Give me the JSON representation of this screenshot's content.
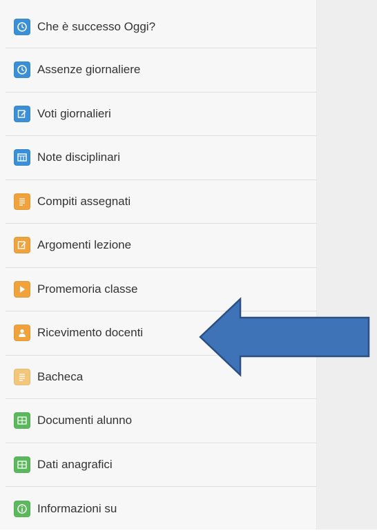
{
  "menu": {
    "items": [
      {
        "label": "Che è successo Oggi?",
        "icon": "clock-icon",
        "color": "#3a8fd6"
      },
      {
        "label": "Assenze giornaliere",
        "icon": "clock-icon",
        "color": "#3a8fd6"
      },
      {
        "label": "Voti giornalieri",
        "icon": "edit-icon",
        "color": "#3a8fd6"
      },
      {
        "label": "Note disciplinari",
        "icon": "calendar-icon",
        "color": "#3a8fd6"
      },
      {
        "label": "Compiti assegnati",
        "icon": "document-icon",
        "color": "#f0a23c"
      },
      {
        "label": "Argomenti lezione",
        "icon": "edit-icon",
        "color": "#f0a23c"
      },
      {
        "label": "Promemoria classe",
        "icon": "pin-icon",
        "color": "#f0a23c"
      },
      {
        "label": "Ricevimento docenti",
        "icon": "person-icon",
        "color": "#f0a23c"
      },
      {
        "label": "Bacheca",
        "icon": "document-icon",
        "color": "#f2c77a"
      },
      {
        "label": "Documenti alunno",
        "icon": "grid-icon",
        "color": "#5cb85c"
      },
      {
        "label": "Dati anagrafici",
        "icon": "grid-icon",
        "color": "#5cb85c"
      },
      {
        "label": "Informazioni su",
        "icon": "info-icon",
        "color": "#5cb85c"
      }
    ]
  },
  "annotation": {
    "arrow_color": "#3f73b8",
    "points_to": "Ricevimento docenti"
  }
}
